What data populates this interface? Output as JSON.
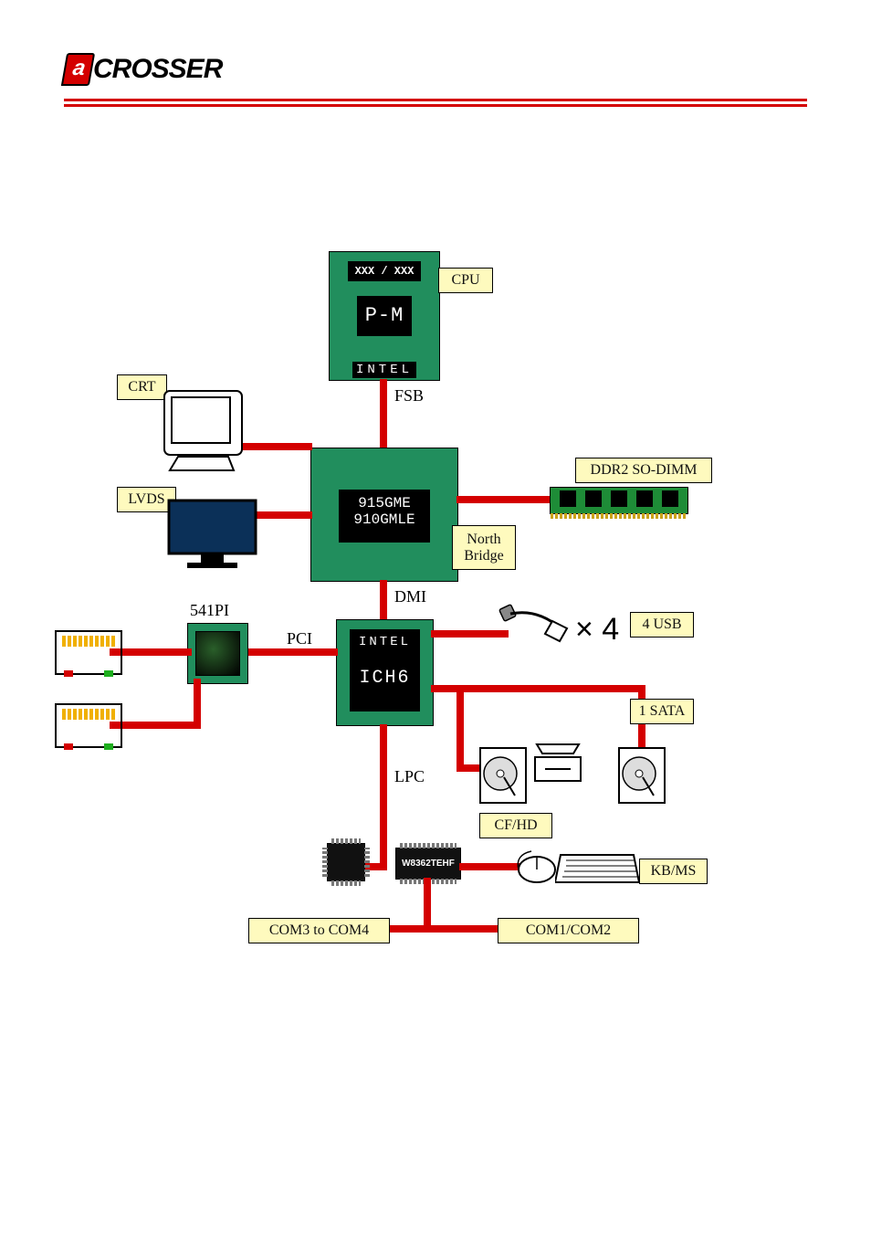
{
  "brand": "CROSSER",
  "cpu": {
    "vendor": "INTEL",
    "model": "P-M",
    "sku": "XXX / XXX",
    "bus": "FSB"
  },
  "northbridge": {
    "chip1": "915GME",
    "chip2": "910GMLE",
    "label": "North Bridge",
    "bus": "DMI"
  },
  "southbridge": {
    "vendor": "INTEL",
    "model": "ICH6",
    "pci": "PCI",
    "lpc": "LPC"
  },
  "ethernet": {
    "chip": "541PI"
  },
  "superio": {
    "chip": "W8362TEHF"
  },
  "labels": {
    "cpu": "CPU",
    "crt": "CRT",
    "lvds": "LVDS",
    "ddr": "DDR2 SO-DIMM",
    "usb": "4 USB",
    "usb_mult": "× 4",
    "sata": "1 SATA",
    "cfhd": "CF/HD",
    "kbms": "KB/MS",
    "com12": "COM1/COM2",
    "com34": "COM3 to COM4"
  }
}
